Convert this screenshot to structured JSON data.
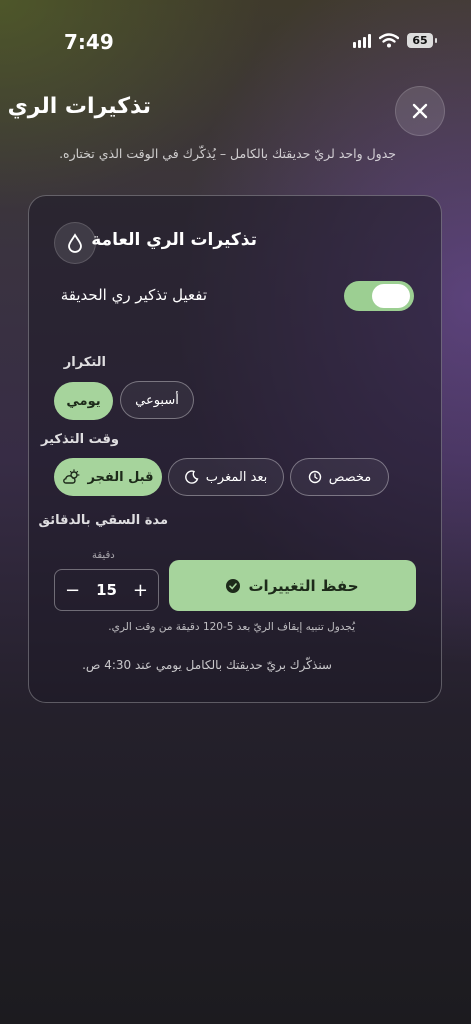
{
  "status_bar": {
    "time": "7:49",
    "battery": "65"
  },
  "header": {
    "title": "تذكيرات الري",
    "subtitle": "جدول واحد لريّ حديقتك بالكامل – يُذكّرك في الوقت الذي تختاره."
  },
  "card": {
    "title": "تذكيرات الري العامة",
    "toggle_label": "تفعيل تذكير ري الحديقة",
    "toggle_on": true,
    "frequency": {
      "label": "التكرار",
      "options": [
        "يومي",
        "أسبوعي"
      ],
      "selected": "يومي"
    },
    "reminder_time": {
      "label": "وقت التذكير",
      "options": [
        "قبل الفجر",
        "بعد المغرب",
        "مخصص"
      ],
      "selected": "قبل الفجر"
    },
    "duration": {
      "label": "مدة السقي بالدقائق",
      "unit": "دقيقة",
      "value": "15",
      "minus": "−",
      "plus": "+"
    },
    "save_label": "حفظ التغييرات",
    "hint": "يُجدول تنبيه إيقاف الريّ بعد 5-120 دقيقة من وقت الري.",
    "summary": "سنذكّرك بريّ حديقتك بالكامل يومي عند 4:30 ص."
  },
  "colors": {
    "accent": "#a6d49c"
  }
}
